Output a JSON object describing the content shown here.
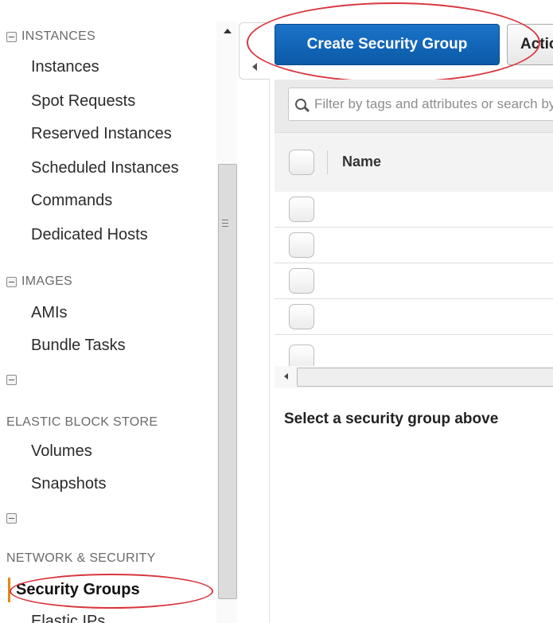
{
  "sidebar": {
    "instances_header": "INSTANCES",
    "instances_items": [
      "Instances",
      "Spot Requests",
      "Reserved Instances",
      "Scheduled Instances",
      "Commands",
      "Dedicated Hosts"
    ],
    "images_header": "IMAGES",
    "images_items": [
      "AMIs",
      "Bundle Tasks"
    ],
    "ebs_header": "ELASTIC BLOCK STORE",
    "ebs_items": [
      "Volumes",
      "Snapshots"
    ],
    "network_header": "NETWORK & SECURITY",
    "network_items": [
      "Security Groups",
      "Elastic IPs"
    ],
    "active_item": "Security Groups"
  },
  "toolbar": {
    "create_label": "Create Security Group",
    "actions_label": "Actions"
  },
  "filter": {
    "placeholder": "Filter by tags and attributes or search by keyword"
  },
  "table": {
    "columns": [
      "Name"
    ],
    "rows": [
      {},
      {},
      {},
      {}
    ]
  },
  "details": {
    "empty_message": "Select a security group above"
  },
  "colors": {
    "primary_button": "#0b5aa7",
    "annotation": "#d9363e",
    "active_marker": "#e48a14"
  }
}
